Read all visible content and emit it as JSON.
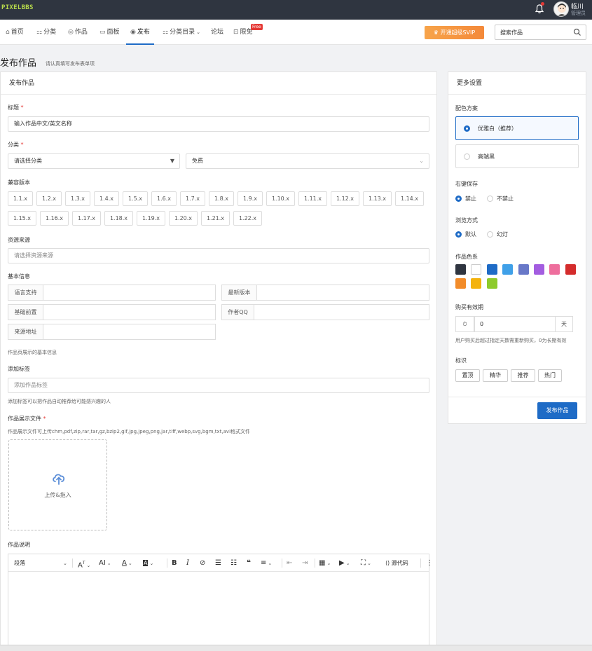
{
  "brand": "PIXELBBS",
  "user": {
    "name": "临川",
    "role": "管理员"
  },
  "nav": [
    {
      "label": "首页",
      "icon": "home-icon",
      "glyph": "⌂"
    },
    {
      "label": "分类",
      "icon": "category-icon",
      "glyph": "⚏"
    },
    {
      "label": "作品",
      "icon": "camera-icon",
      "glyph": "◎"
    },
    {
      "label": "面板",
      "icon": "monitor-icon",
      "glyph": "▭"
    },
    {
      "label": "发布",
      "icon": "eye-icon",
      "glyph": "◉"
    },
    {
      "label": "分类目录",
      "icon": "grid-icon",
      "glyph": "⚏"
    },
    {
      "label": "论坛",
      "icon": "",
      "glyph": ""
    },
    {
      "label": "限免",
      "icon": "lock-icon",
      "glyph": "⊡"
    }
  ],
  "free_badge": "Free",
  "svip_label": "开通超级SVIP",
  "search": {
    "placeholder": "搜索作品"
  },
  "page": {
    "title": "发布作品",
    "subtitle": "请认真填写发布表单项"
  },
  "form": {
    "panel_title": "发布作品",
    "title_label": "标题",
    "title_placeholder": "输入作品中文/英文名称",
    "category_label": "分类",
    "category_value": "请选择分类",
    "price_value": "免费",
    "compat_label": "兼容版本",
    "versions_row1": [
      "1.1.x",
      "1.2.x",
      "1.3.x",
      "1.4.x",
      "1.5.x",
      "1.6.x",
      "1.7.x",
      "1.8.x",
      "1.9.x",
      "1.10.x",
      "1.11.x",
      "1.12.x",
      "1.13.x",
      "1.14.x"
    ],
    "versions_row2": [
      "1.15.x",
      "1.16.x",
      "1.17.x",
      "1.18.x",
      "1.19.x",
      "1.20.x",
      "1.21.x",
      "1.22.x"
    ],
    "source_label": "资源来源",
    "source_placeholder": "请选择资源来源",
    "basic_label": "基本信息",
    "basic_fields": [
      "语言支持",
      "最新版本",
      "基础前置",
      "作者QQ",
      "来源地址"
    ],
    "basic_hint": "作品页展示的基本信息",
    "tags_label": "添加标签",
    "tags_placeholder": "添加作品标签",
    "tags_hint": "添加标签可以把作品自动推荐给可能感兴趣的人",
    "files_label": "作品展示文件",
    "files_hint": "作品展示文件可上传chm,pdf,zip,rar,tar,gz,bzip2,gif,jpg,jpeg,png,jar,tiff,webp,svg,bgm,txt,avi格式文件",
    "upload_label": "上传&拖入",
    "desc_label": "作品说明",
    "editor": {
      "paragraph": "段落",
      "code": "源代码"
    }
  },
  "settings": {
    "panel_title": "更多设置",
    "scheme_label": "配色方案",
    "scheme_options": [
      "优雅白（推荐）",
      "高端黑"
    ],
    "rightclick_label": "右键保存",
    "rightclick_options": [
      "禁止",
      "不禁止"
    ],
    "browse_label": "浏览方式",
    "browse_options": [
      "默认",
      "幻灯"
    ],
    "color_label": "作品色系",
    "colors": [
      "#2f3540",
      "#ffffff",
      "#1e6bc6",
      "#3fa0e8",
      "#6878c8",
      "#a35de0",
      "#ee6e9d",
      "#d42c2c",
      "#f28c2a",
      "#f4b30d",
      "#8ecb2c"
    ],
    "validity_label": "购买有效期",
    "validity_value": "0",
    "validity_unit": "天",
    "validity_hint": "用户购买后超过指定天数需重新购买，0为长期有效",
    "mark_label": "标识",
    "marks": [
      "置顶",
      "精华",
      "推荐",
      "热门"
    ],
    "publish_label": "发布作品"
  }
}
